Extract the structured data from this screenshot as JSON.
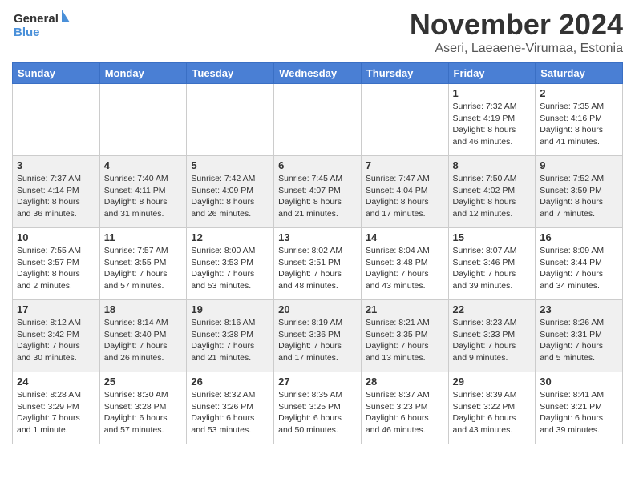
{
  "header": {
    "logo_line1": "General",
    "logo_line2": "Blue",
    "month_title": "November 2024",
    "location": "Aseri, Laeaene-Virumaa, Estonia"
  },
  "weekdays": [
    "Sunday",
    "Monday",
    "Tuesday",
    "Wednesday",
    "Thursday",
    "Friday",
    "Saturday"
  ],
  "weeks": [
    [
      {
        "day": "",
        "info": ""
      },
      {
        "day": "",
        "info": ""
      },
      {
        "day": "",
        "info": ""
      },
      {
        "day": "",
        "info": ""
      },
      {
        "day": "",
        "info": ""
      },
      {
        "day": "1",
        "info": "Sunrise: 7:32 AM\nSunset: 4:19 PM\nDaylight: 8 hours and 46 minutes."
      },
      {
        "day": "2",
        "info": "Sunrise: 7:35 AM\nSunset: 4:16 PM\nDaylight: 8 hours and 41 minutes."
      }
    ],
    [
      {
        "day": "3",
        "info": "Sunrise: 7:37 AM\nSunset: 4:14 PM\nDaylight: 8 hours and 36 minutes."
      },
      {
        "day": "4",
        "info": "Sunrise: 7:40 AM\nSunset: 4:11 PM\nDaylight: 8 hours and 31 minutes."
      },
      {
        "day": "5",
        "info": "Sunrise: 7:42 AM\nSunset: 4:09 PM\nDaylight: 8 hours and 26 minutes."
      },
      {
        "day": "6",
        "info": "Sunrise: 7:45 AM\nSunset: 4:07 PM\nDaylight: 8 hours and 21 minutes."
      },
      {
        "day": "7",
        "info": "Sunrise: 7:47 AM\nSunset: 4:04 PM\nDaylight: 8 hours and 17 minutes."
      },
      {
        "day": "8",
        "info": "Sunrise: 7:50 AM\nSunset: 4:02 PM\nDaylight: 8 hours and 12 minutes."
      },
      {
        "day": "9",
        "info": "Sunrise: 7:52 AM\nSunset: 3:59 PM\nDaylight: 8 hours and 7 minutes."
      }
    ],
    [
      {
        "day": "10",
        "info": "Sunrise: 7:55 AM\nSunset: 3:57 PM\nDaylight: 8 hours and 2 minutes."
      },
      {
        "day": "11",
        "info": "Sunrise: 7:57 AM\nSunset: 3:55 PM\nDaylight: 7 hours and 57 minutes."
      },
      {
        "day": "12",
        "info": "Sunrise: 8:00 AM\nSunset: 3:53 PM\nDaylight: 7 hours and 53 minutes."
      },
      {
        "day": "13",
        "info": "Sunrise: 8:02 AM\nSunset: 3:51 PM\nDaylight: 7 hours and 48 minutes."
      },
      {
        "day": "14",
        "info": "Sunrise: 8:04 AM\nSunset: 3:48 PM\nDaylight: 7 hours and 43 minutes."
      },
      {
        "day": "15",
        "info": "Sunrise: 8:07 AM\nSunset: 3:46 PM\nDaylight: 7 hours and 39 minutes."
      },
      {
        "day": "16",
        "info": "Sunrise: 8:09 AM\nSunset: 3:44 PM\nDaylight: 7 hours and 34 minutes."
      }
    ],
    [
      {
        "day": "17",
        "info": "Sunrise: 8:12 AM\nSunset: 3:42 PM\nDaylight: 7 hours and 30 minutes."
      },
      {
        "day": "18",
        "info": "Sunrise: 8:14 AM\nSunset: 3:40 PM\nDaylight: 7 hours and 26 minutes."
      },
      {
        "day": "19",
        "info": "Sunrise: 8:16 AM\nSunset: 3:38 PM\nDaylight: 7 hours and 21 minutes."
      },
      {
        "day": "20",
        "info": "Sunrise: 8:19 AM\nSunset: 3:36 PM\nDaylight: 7 hours and 17 minutes."
      },
      {
        "day": "21",
        "info": "Sunrise: 8:21 AM\nSunset: 3:35 PM\nDaylight: 7 hours and 13 minutes."
      },
      {
        "day": "22",
        "info": "Sunrise: 8:23 AM\nSunset: 3:33 PM\nDaylight: 7 hours and 9 minutes."
      },
      {
        "day": "23",
        "info": "Sunrise: 8:26 AM\nSunset: 3:31 PM\nDaylight: 7 hours and 5 minutes."
      }
    ],
    [
      {
        "day": "24",
        "info": "Sunrise: 8:28 AM\nSunset: 3:29 PM\nDaylight: 7 hours and 1 minute."
      },
      {
        "day": "25",
        "info": "Sunrise: 8:30 AM\nSunset: 3:28 PM\nDaylight: 6 hours and 57 minutes."
      },
      {
        "day": "26",
        "info": "Sunrise: 8:32 AM\nSunset: 3:26 PM\nDaylight: 6 hours and 53 minutes."
      },
      {
        "day": "27",
        "info": "Sunrise: 8:35 AM\nSunset: 3:25 PM\nDaylight: 6 hours and 50 minutes."
      },
      {
        "day": "28",
        "info": "Sunrise: 8:37 AM\nSunset: 3:23 PM\nDaylight: 6 hours and 46 minutes."
      },
      {
        "day": "29",
        "info": "Sunrise: 8:39 AM\nSunset: 3:22 PM\nDaylight: 6 hours and 43 minutes."
      },
      {
        "day": "30",
        "info": "Sunrise: 8:41 AM\nSunset: 3:21 PM\nDaylight: 6 hours and 39 minutes."
      }
    ]
  ]
}
